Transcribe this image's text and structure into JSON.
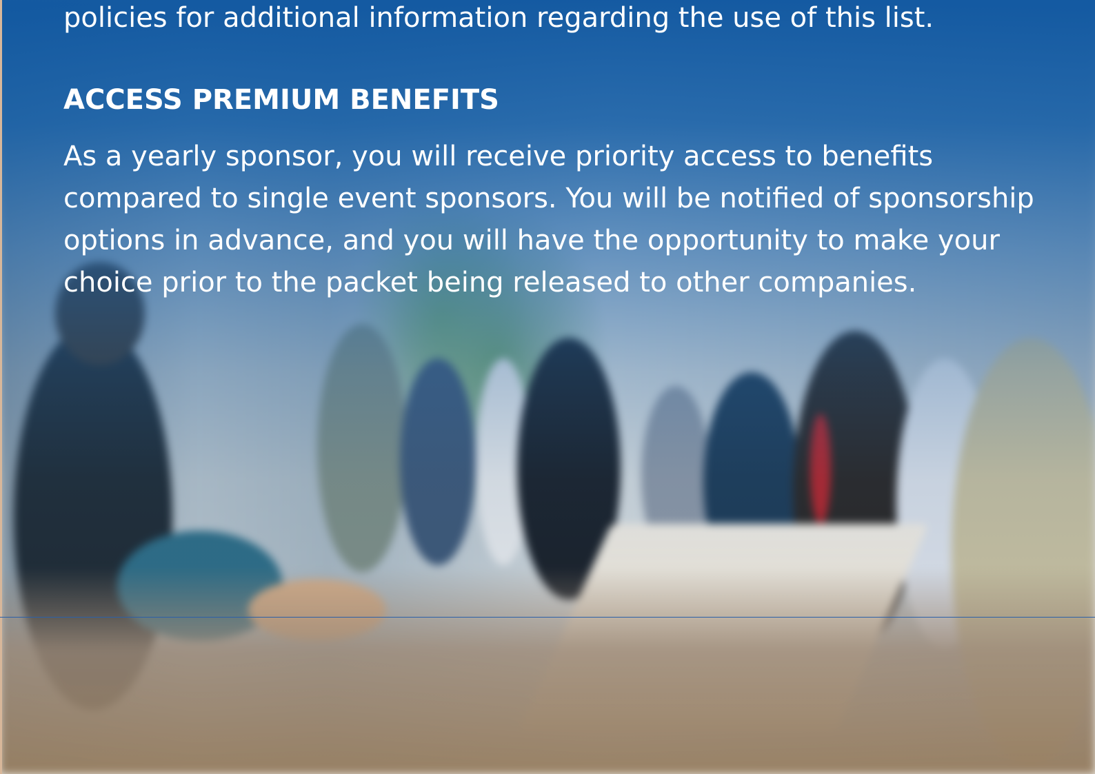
{
  "intro_text": "policies for additional information regarding the use of this list.",
  "section": {
    "heading": "ACCESS PREMIUM BENEFITS",
    "body": "As a yearly sponsor, you will receive priority access to benefits compared to single event sponsors. You will be notified of sponsorship options in advance, and you will have the opportunity to make your choice prior to the packet being released to other companies."
  },
  "colors": {
    "overlay_blue": "#0e56a0",
    "text": "#ffffff",
    "rule": "#2a5fa8"
  }
}
